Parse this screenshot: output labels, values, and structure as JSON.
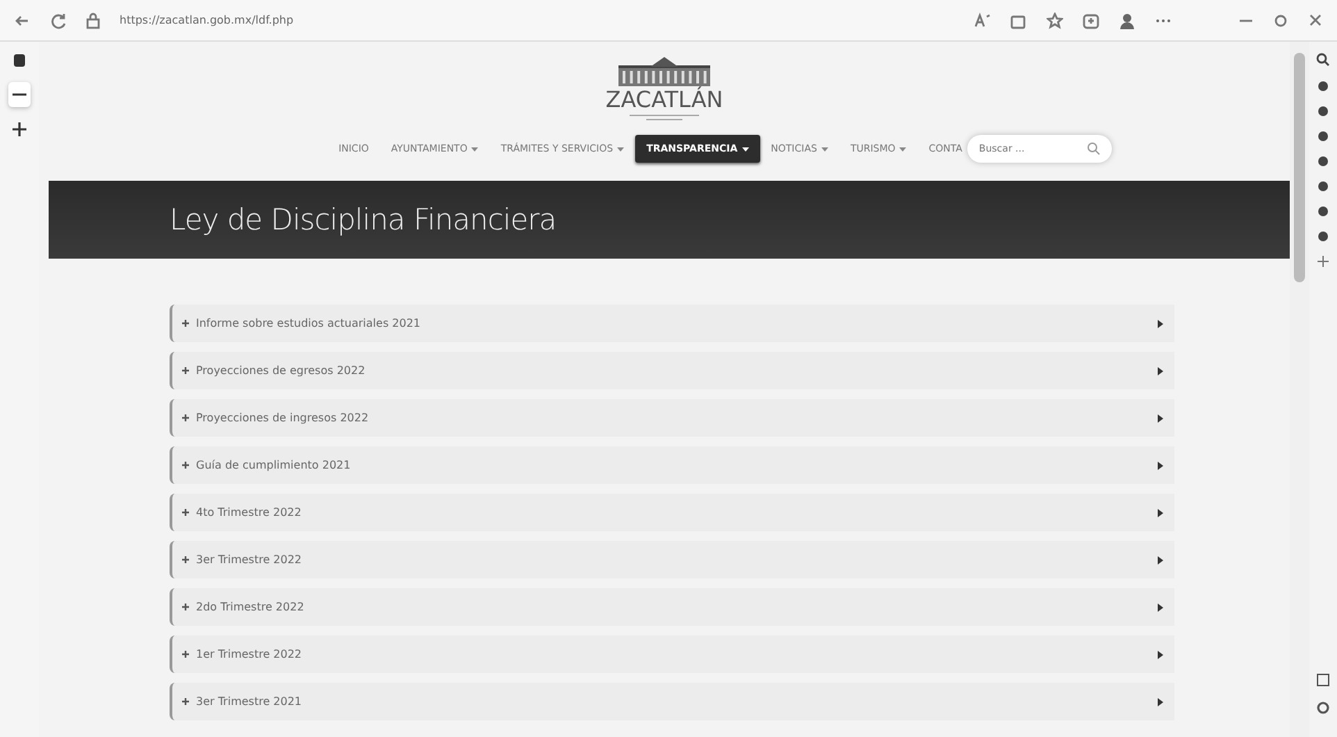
{
  "browser": {
    "url": "https://zacatlan.gob.mx/ldf.php"
  },
  "logo": {
    "name": "ZACATLÁN"
  },
  "nav": [
    {
      "label": "INICIO",
      "dropdown": false,
      "selected": false
    },
    {
      "label": "AYUNTAMIENTO",
      "dropdown": true,
      "selected": false
    },
    {
      "label": "TRÁMITES Y SERVICIOS",
      "dropdown": true,
      "selected": false
    },
    {
      "label": "TRANSPARENCIA",
      "dropdown": true,
      "selected": true
    },
    {
      "label": "NOTICIAS",
      "dropdown": true,
      "selected": false
    },
    {
      "label": "TURISMO",
      "dropdown": true,
      "selected": false
    },
    {
      "label": "CONTA",
      "dropdown": false,
      "selected": false
    }
  ],
  "search": {
    "placeholder": "Buscar ..."
  },
  "banner": {
    "title": "Ley de Disciplina Financiera"
  },
  "sections": [
    {
      "label": "Informe sobre estudios actuariales 2021"
    },
    {
      "label": "Proyecciones de egresos 2022"
    },
    {
      "label": "Proyecciones de ingresos 2022"
    },
    {
      "label": "Guía de cumplimiento 2021"
    },
    {
      "label": "4to Trimestre 2022"
    },
    {
      "label": "3er Trimestre 2022"
    },
    {
      "label": "2do Trimestre 2022"
    },
    {
      "label": "1er Trimestre 2022"
    },
    {
      "label": "3er Trimestre 2021"
    }
  ]
}
